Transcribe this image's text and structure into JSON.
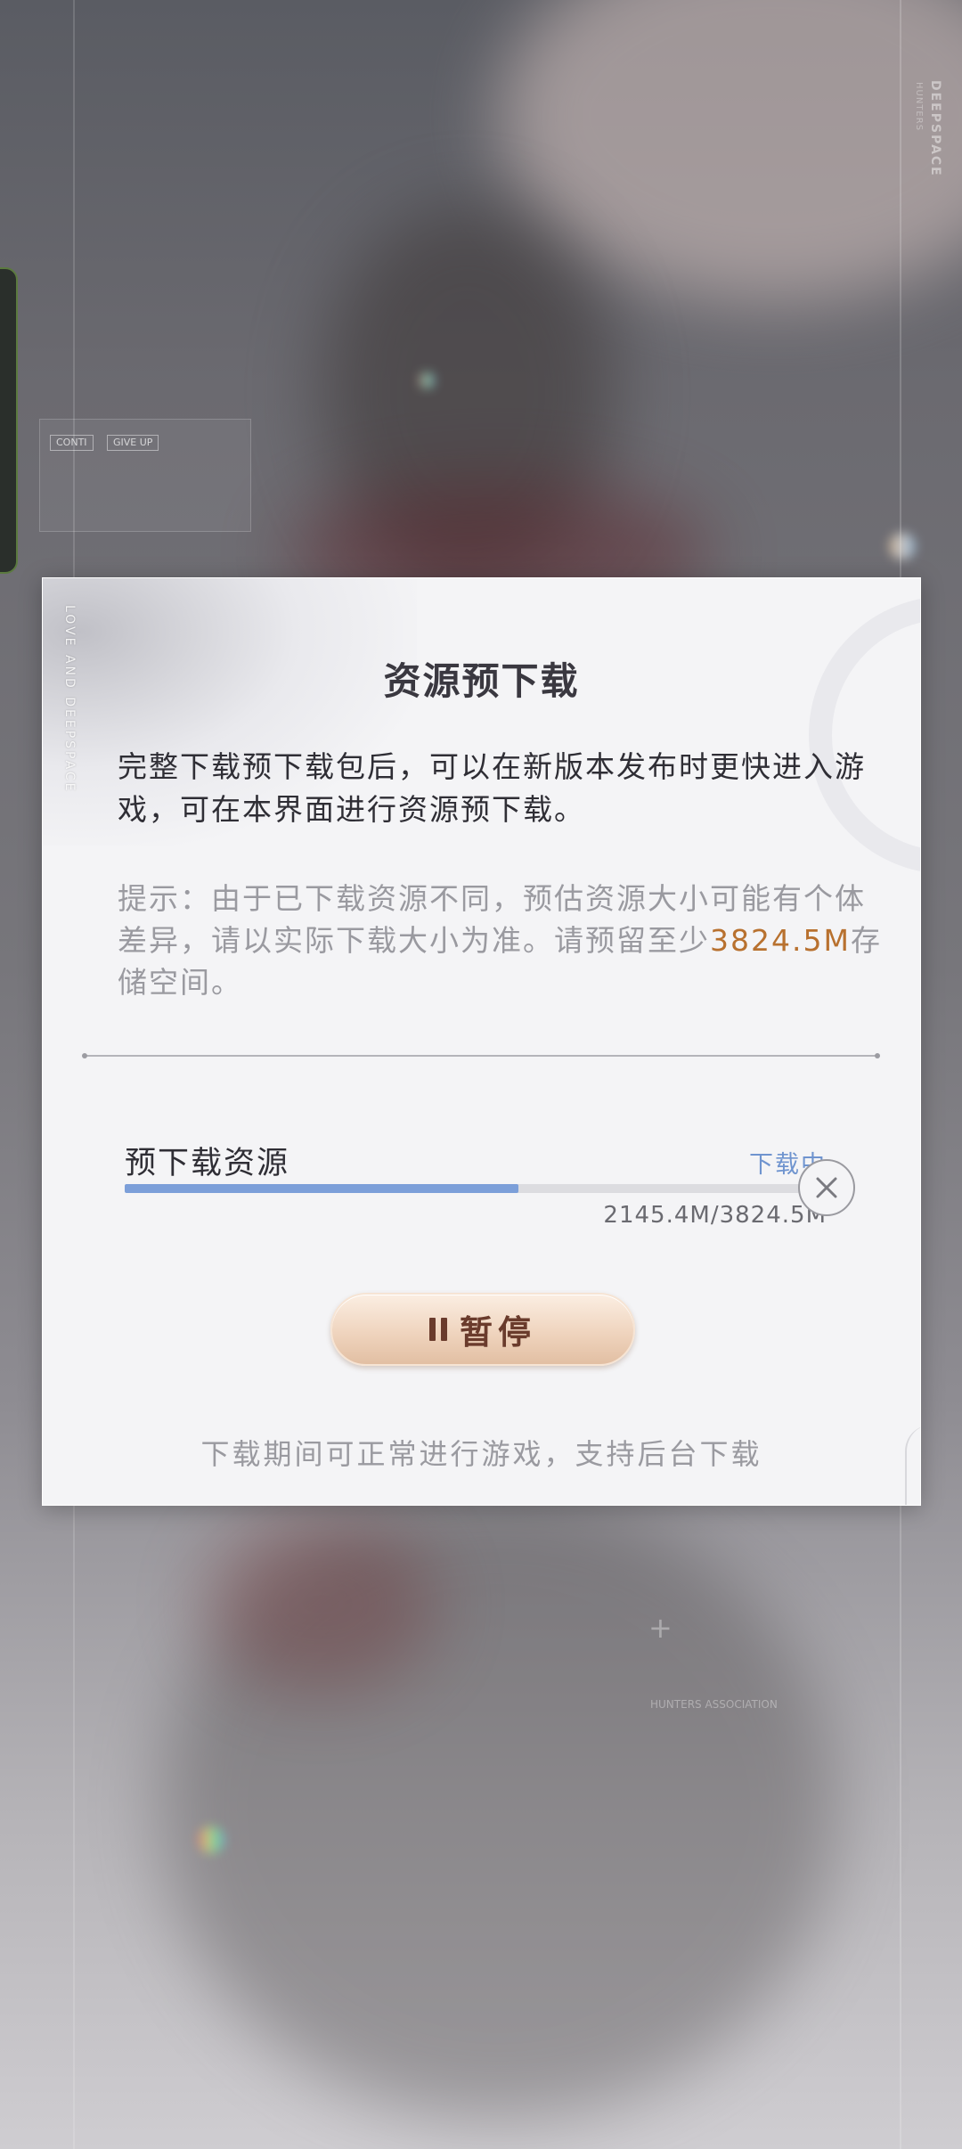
{
  "background": {
    "brand_vertical": "DEEPSPACE",
    "brand_sub": "HUNTERS",
    "chip_left": "CONTI",
    "chip_right": "GIVE UP",
    "association_text": "HUNTERS ASSOCIATION"
  },
  "dialog": {
    "side_brand": "LOVE AND DEEPSPACE",
    "title": "资源预下载",
    "description": "完整下载预下载包后，可以在新版本发布时更快进入游戏，可在本界面进行资源预下载。",
    "tip_prefix": "提示：由于已下载资源不同，预估资源大小可能有个体差异，请以实际下载大小为准。请预留至少",
    "tip_size": "3824.5M",
    "tip_suffix": "存储空间。",
    "download": {
      "label": "预下载资源",
      "status": "下载中",
      "size_text": "2145.4M/3824.5M",
      "progress_fraction": 0.561
    },
    "pause_label": "暂停",
    "footer": "下载期间可正常进行游戏，支持后台下载"
  },
  "colors": {
    "accent_blue": "#7c9fd9",
    "highlight_orange": "#b8712f",
    "button_brown": "#6a3b2c"
  },
  "icons": {
    "cancel": "close-circle-icon",
    "pause": "pause-icon"
  }
}
